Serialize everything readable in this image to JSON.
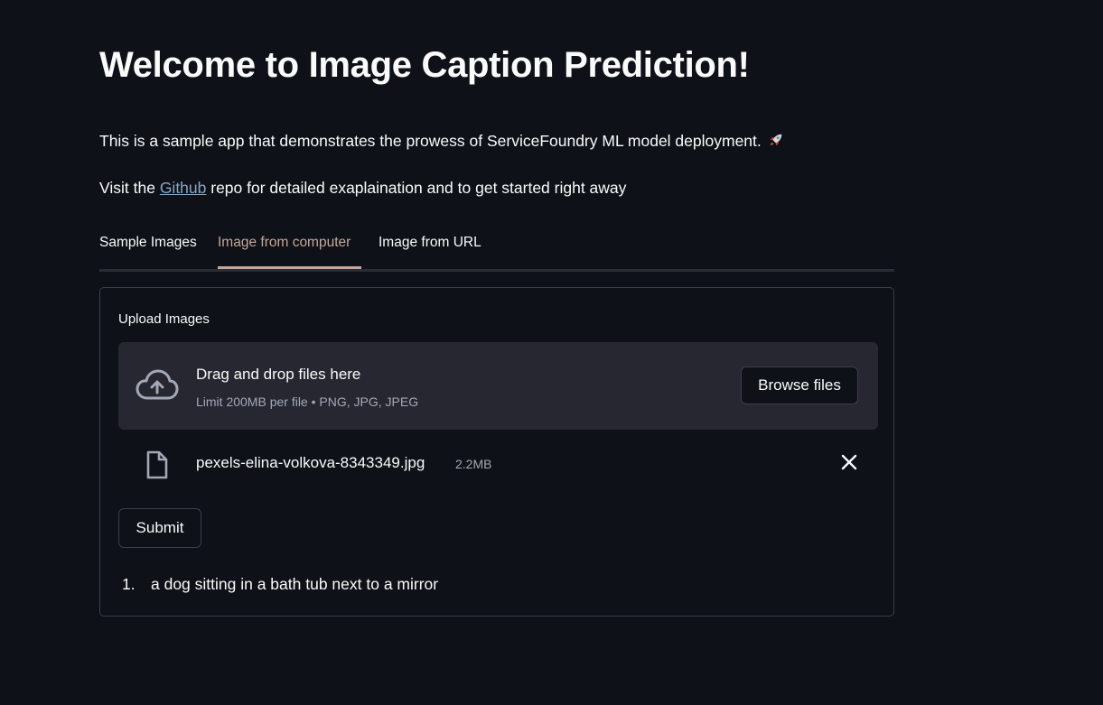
{
  "page": {
    "title": "Welcome to Image Caption Prediction!",
    "intro": "This is a sample app that demonstrates the prowess of ServiceFoundry ML model deployment.",
    "intro_icon": "rocket-icon",
    "visit_prefix": "Visit the",
    "visit_link": "Github",
    "visit_suffix": "repo for detailed exaplaination and to get started right away"
  },
  "tabs": [
    {
      "label": "Sample Images",
      "active": false
    },
    {
      "label": "Image from computer",
      "active": true
    },
    {
      "label": "Image from URL",
      "active": false
    }
  ],
  "uploader": {
    "label": "Upload Images",
    "drop_text": "Drag and drop files here",
    "limit_text": "Limit 200MB per file • PNG, JPG, JPEG",
    "browse_label": "Browse files",
    "icon": "cloud-upload-icon"
  },
  "file": {
    "name": "pexels-elina-volkova-8343349.jpg",
    "size": "2.2MB",
    "icon": "file-icon",
    "remove_icon": "close-icon"
  },
  "submit_label": "Submit",
  "results": [
    {
      "num": "1.",
      "text": "a dog sitting in a bath tub next to a mirror"
    }
  ],
  "colors": {
    "background": "#0e1117",
    "text": "#fafafa",
    "link": "#8aa6c1",
    "active_tab": "#c6a79a",
    "dropzone": "#262730",
    "muted": "#a3a8b8"
  }
}
